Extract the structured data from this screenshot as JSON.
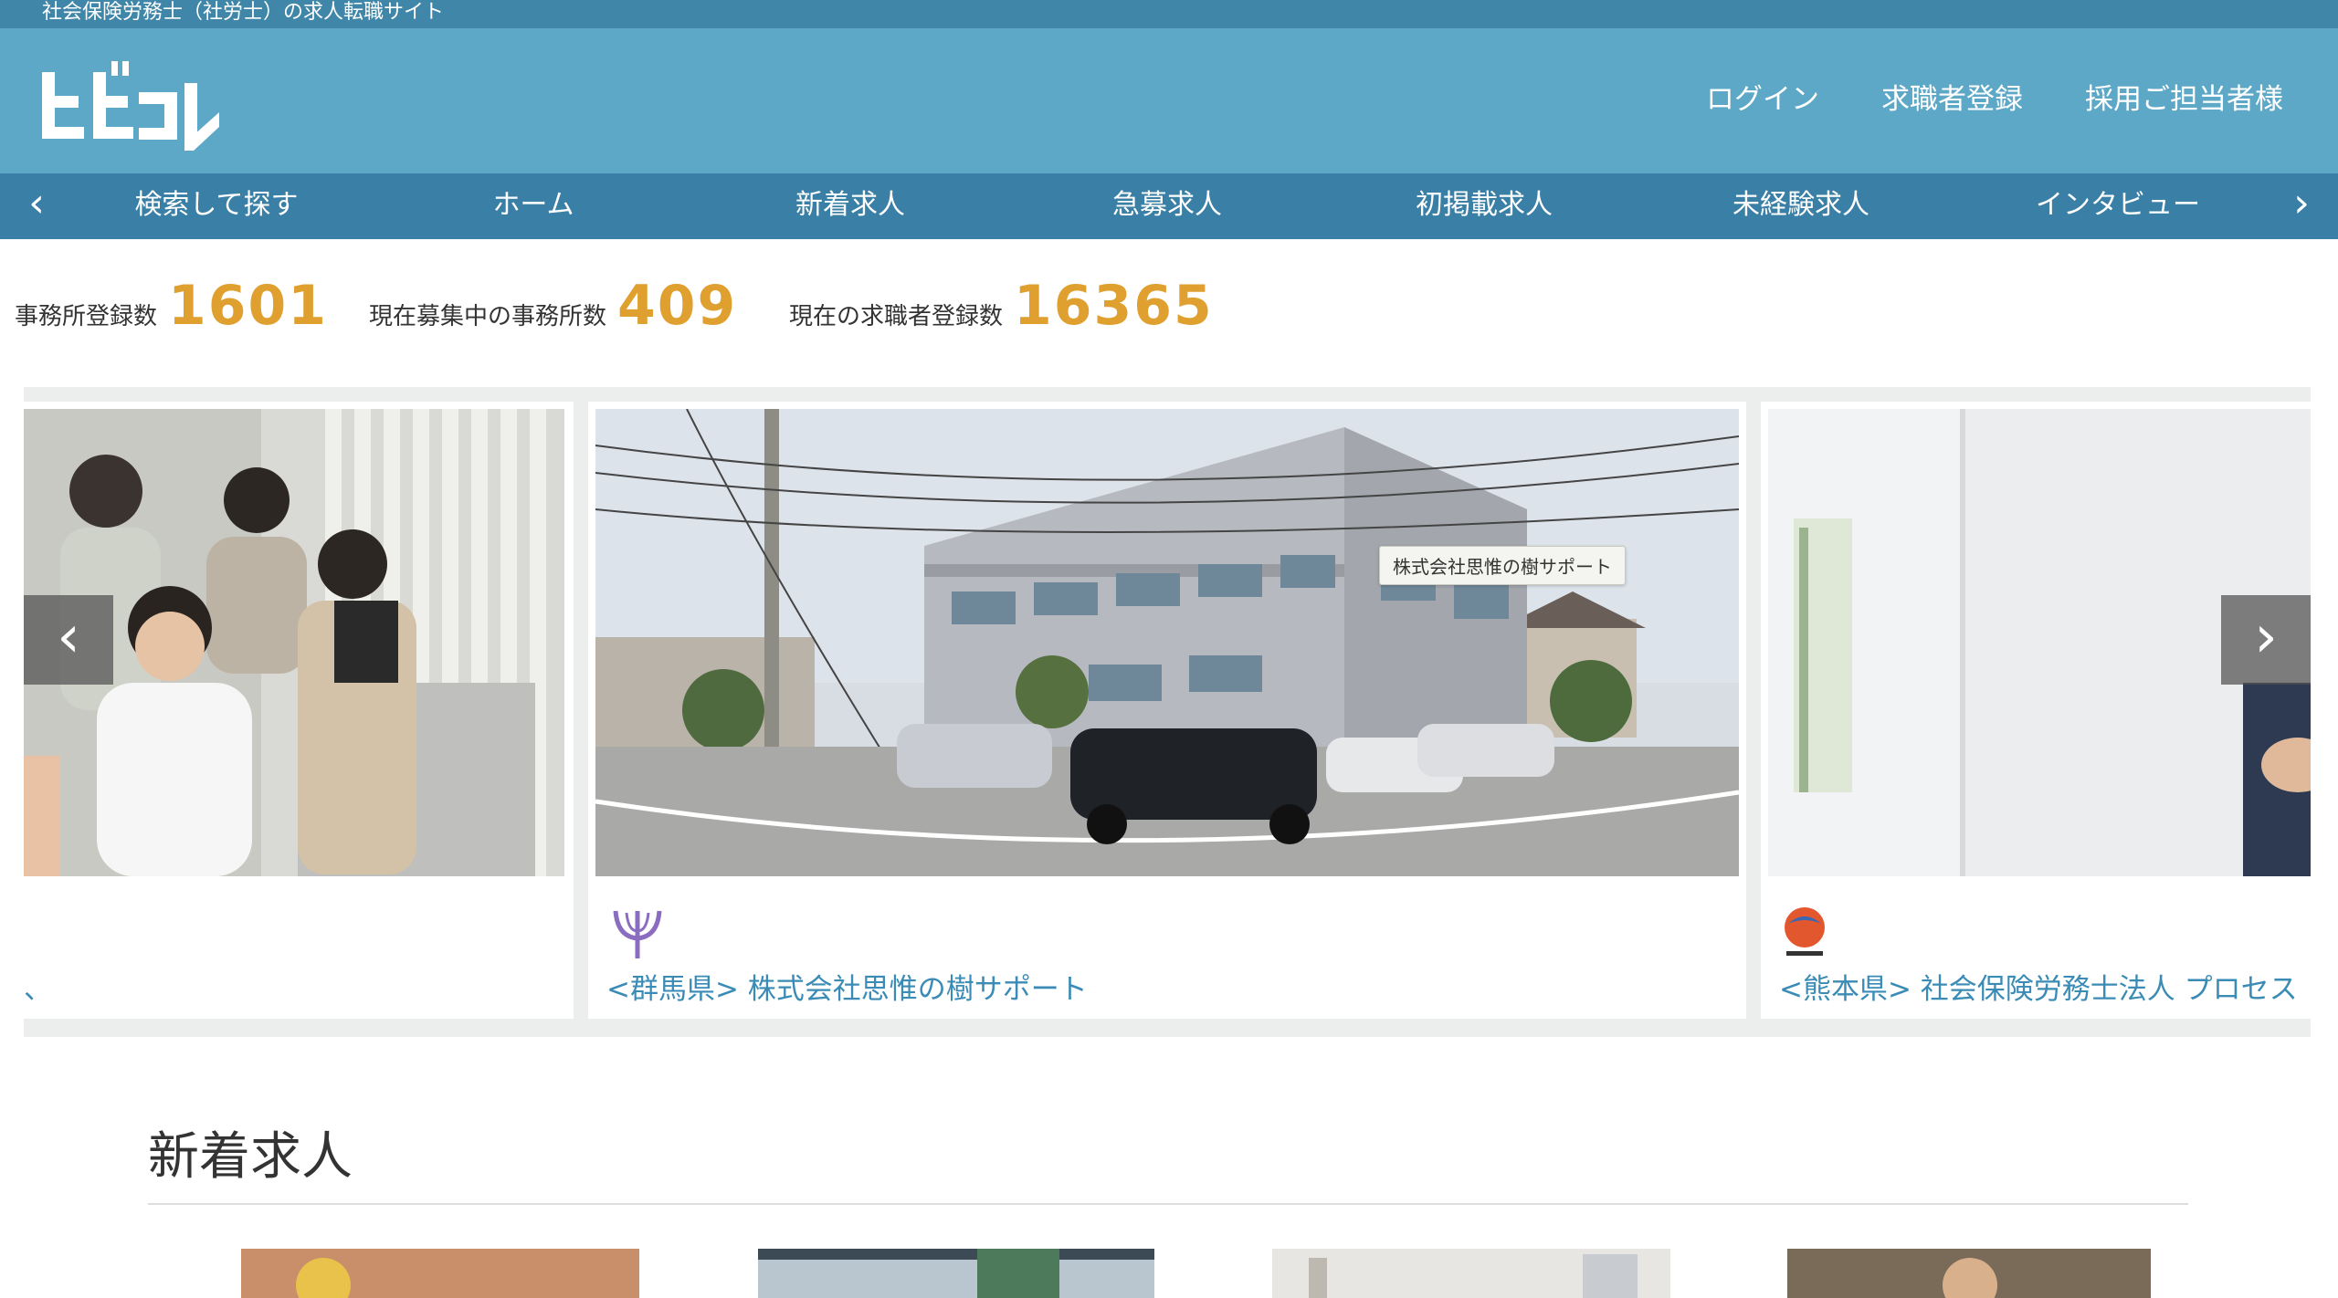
{
  "site": {
    "tagline": "社会保険労務士（社労士）の求人転職サイト",
    "logo_text": "ヒビコレ"
  },
  "header_nav": [
    {
      "label": "ログイン"
    },
    {
      "label": "求職者登録"
    },
    {
      "label": "採用ご担当者様"
    }
  ],
  "nav": {
    "items": [
      {
        "label": "検索して探す"
      },
      {
        "label": "ホーム"
      },
      {
        "label": "新着求人"
      },
      {
        "label": "急募求人"
      },
      {
        "label": "初掲載求人"
      },
      {
        "label": "未経験求人"
      },
      {
        "label": "インタビュー"
      }
    ],
    "prev_icon": "‹",
    "next_icon": "›"
  },
  "stats": [
    {
      "label": "事務所登録数",
      "value": "1601"
    },
    {
      "label": "現在募集中の事務所数",
      "value": "409"
    },
    {
      "label": "現在の求職者登録数",
      "value": "16365"
    }
  ],
  "carousel": {
    "slides": [
      {
        "caption": "、"
      },
      {
        "caption": "<群馬県> 株式会社思惟の樹サポート"
      },
      {
        "caption": "<熊本県> 社会保険労務士法人 プロセス"
      }
    ],
    "tooltip": "株式会社思惟の樹サポート",
    "prev_icon": "‹",
    "next_icon": "›",
    "colors": {
      "accent_number": "#e0a030",
      "link": "#3a8bb5",
      "header": "#5da7c7",
      "navbar": "#3a7fa5"
    }
  },
  "section": {
    "title": "新着求人"
  }
}
